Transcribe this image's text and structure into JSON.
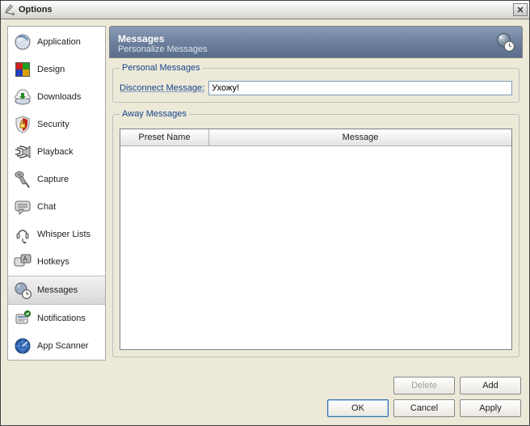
{
  "window": {
    "title": "Options",
    "close_glyph": "✕"
  },
  "sidebar": {
    "items": [
      {
        "label": "Application",
        "icon": "app",
        "selected": false
      },
      {
        "label": "Design",
        "icon": "design",
        "selected": false
      },
      {
        "label": "Downloads",
        "icon": "downloads",
        "selected": false
      },
      {
        "label": "Security",
        "icon": "security",
        "selected": false
      },
      {
        "label": "Playback",
        "icon": "playback",
        "selected": false
      },
      {
        "label": "Capture",
        "icon": "capture",
        "selected": false
      },
      {
        "label": "Chat",
        "icon": "chat",
        "selected": false
      },
      {
        "label": "Whisper Lists",
        "icon": "whisper",
        "selected": false
      },
      {
        "label": "Hotkeys",
        "icon": "hotkeys",
        "selected": false
      },
      {
        "label": "Messages",
        "icon": "messages",
        "selected": true
      },
      {
        "label": "Notifications",
        "icon": "notify",
        "selected": false
      },
      {
        "label": "App Scanner",
        "icon": "scanner",
        "selected": false
      }
    ]
  },
  "header": {
    "title": "Messages",
    "subtitle": "Personalize Messages"
  },
  "personal": {
    "legend": "Personal Messages",
    "disconnect_label": "Disconnect Message:",
    "disconnect_value": "Ухожу!"
  },
  "away": {
    "legend": "Away Messages",
    "columns": {
      "preset": "Preset Name",
      "message": "Message"
    },
    "rows": []
  },
  "buttons": {
    "delete": "Delete",
    "add": "Add",
    "ok": "OK",
    "cancel": "Cancel",
    "apply": "Apply"
  }
}
